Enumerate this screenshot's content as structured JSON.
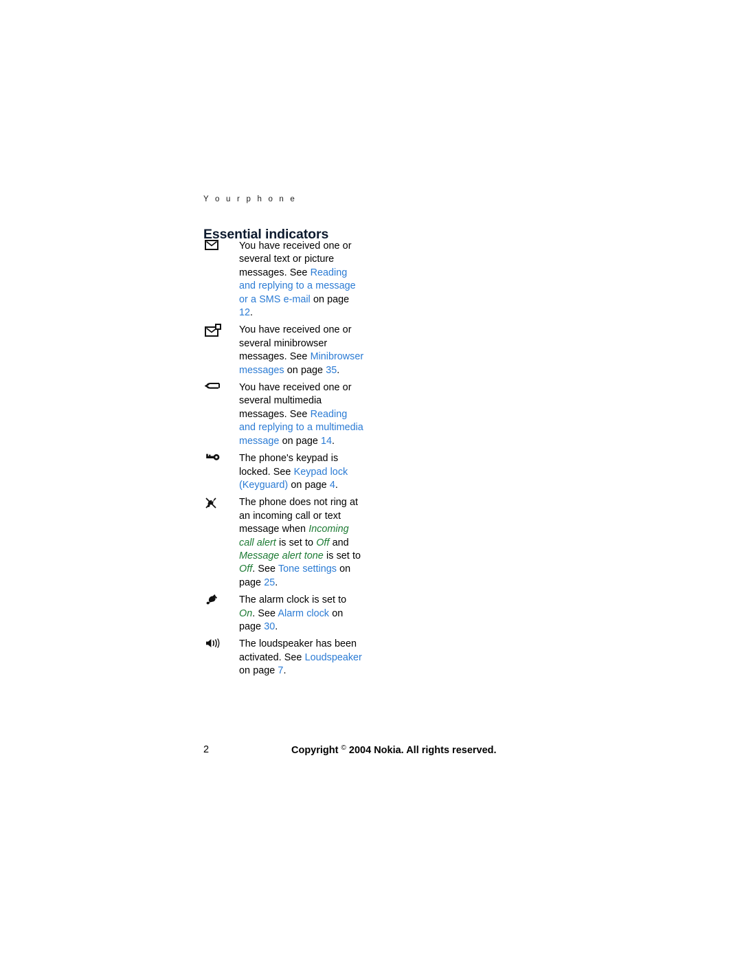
{
  "header": {
    "running_head": "Y o u r   p h o n e"
  },
  "heading": "Essential indicators",
  "colors": {
    "link": "#2b7bd4",
    "term": "#1c7a33",
    "body": "#000000",
    "heading": "#0d1a2e"
  },
  "indicators": [
    {
      "icon": "envelope-icon",
      "runs": [
        {
          "t": "You have received one or several text or picture messages. See ",
          "s": "plain"
        },
        {
          "t": "Reading and replying to a message or a SMS e-mail",
          "s": "link"
        },
        {
          "t": " on page ",
          "s": "plain"
        },
        {
          "t": "12",
          "s": "link"
        },
        {
          "t": ".",
          "s": "plain"
        }
      ]
    },
    {
      "icon": "envelope-badge-icon",
      "runs": [
        {
          "t": "You have received one or several minibrowser messages. See ",
          "s": "plain"
        },
        {
          "t": "Minibrowser messages",
          "s": "link"
        },
        {
          "t": " on page ",
          "s": "plain"
        },
        {
          "t": "35",
          "s": "link"
        },
        {
          "t": ".",
          "s": "plain"
        }
      ]
    },
    {
      "icon": "paperclip-icon",
      "runs": [
        {
          "t": "You have received one or several multimedia messages. See ",
          "s": "plain"
        },
        {
          "t": "Reading and replying to a multimedia message",
          "s": "link"
        },
        {
          "t": " on page ",
          "s": "plain"
        },
        {
          "t": "14",
          "s": "link"
        },
        {
          "t": ".",
          "s": "plain"
        }
      ]
    },
    {
      "icon": "key-icon",
      "runs": [
        {
          "t": "The phone's keypad is locked. See ",
          "s": "plain"
        },
        {
          "t": "Keypad lock (Keyguard)",
          "s": "link"
        },
        {
          "t": " on page ",
          "s": "plain"
        },
        {
          "t": "4",
          "s": "link"
        },
        {
          "t": ".",
          "s": "plain"
        }
      ]
    },
    {
      "icon": "bell-muted-icon",
      "runs": [
        {
          "t": "The phone does not ring at an incoming call or text message when ",
          "s": "plain"
        },
        {
          "t": "Incoming call alert",
          "s": "term"
        },
        {
          "t": " is set to ",
          "s": "plain"
        },
        {
          "t": "Off",
          "s": "term"
        },
        {
          "t": " and ",
          "s": "plain"
        },
        {
          "t": "Message alert tone",
          "s": "term"
        },
        {
          "t": " is set to ",
          "s": "plain"
        },
        {
          "t": "Off",
          "s": "term"
        },
        {
          "t": ". See ",
          "s": "plain"
        },
        {
          "t": "Tone settings",
          "s": "link"
        },
        {
          "t": " on page ",
          "s": "plain"
        },
        {
          "t": "25",
          "s": "link"
        },
        {
          "t": ".",
          "s": "plain"
        }
      ]
    },
    {
      "icon": "alarm-bell-icon",
      "runs": [
        {
          "t": "The alarm clock is set to ",
          "s": "plain"
        },
        {
          "t": "On",
          "s": "term"
        },
        {
          "t": ". See ",
          "s": "plain"
        },
        {
          "t": "Alarm clock",
          "s": "link"
        },
        {
          "t": " on page ",
          "s": "plain"
        },
        {
          "t": "30",
          "s": "link"
        },
        {
          "t": ".",
          "s": "plain"
        }
      ]
    },
    {
      "icon": "loudspeaker-icon",
      "runs": [
        {
          "t": "The loudspeaker has been activated. See ",
          "s": "plain"
        },
        {
          "t": "Loudspeaker",
          "s": "link"
        },
        {
          "t": " on page ",
          "s": "plain"
        },
        {
          "t": "7",
          "s": "link"
        },
        {
          "t": ".",
          "s": "plain"
        }
      ]
    }
  ],
  "footer": {
    "page_number": "2",
    "copyright_before": "Copyright ",
    "copyright_symbol": "©",
    "copyright_after": " 2004 Nokia. All rights reserved."
  }
}
